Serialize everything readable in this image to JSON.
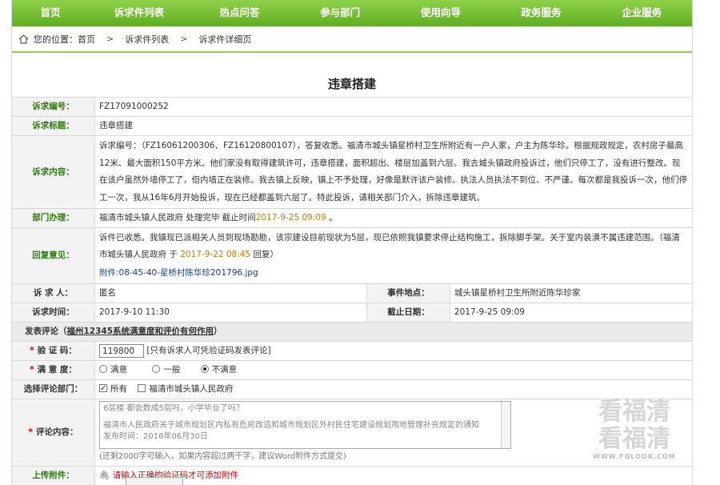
{
  "nav": [
    "首页",
    "诉求件列表",
    "热点问答",
    "参与部门",
    "使用向导",
    "政务服务",
    "企业服务"
  ],
  "breadcrumb": {
    "prefix": "您的位置：",
    "items": [
      "首页",
      "诉求件列表",
      "诉求件详细页"
    ]
  },
  "title": "违章搭建",
  "detail": {
    "id_label": "诉求编号：",
    "id": "FZ17091000252",
    "subject_label": "诉求标题：",
    "subject": "违章搭建",
    "content_label": "诉求内容：",
    "content": "诉求编号：（FZ16061200306、FZ16120800107），答复收悉。福清市城头镇星桥村卫生所附近有一户人家，户主为陈华珍。根据规政规定，农村房子最高12米、最大面积150平方米。他们家没有取得建筑许可，违章搭建，面积超出、楼层加盖到六层。我去城头镇政府投诉过，他们只停工了，没有进行整改。现在该户虽然外墙停工了，但内墙正在装修。我去镇上反映，镇上不予处理，好像是默许该户装修。执法人员执法不到位、不严谨。每次都是我投诉一次，他们停工一次，我从16年6月开始投诉，现在已经都盖到六层了。特此投诉，请相关部门介入，拆除违章建筑。",
    "dept_label": "部门办理：",
    "dept_text": "福清市城头镇人民政府  处理完毕  截止时间",
    "dept_deadline": "2017-9-25 09:09",
    "dept_end": " 。",
    "reply_label": "回复意见：",
    "reply": "诉件已收悉。我镇现已派相关人员到现场勘勘，该宗建设目前现状为5层，现已依照我镇要求停止结构施工，拆除脚手架。关于室内装潢不属违建范围。（福清市城头镇人民政府  于 ",
    "reply_time": "2017-9-22 08:45",
    "reply_end": " 回复）",
    "attachment": "附件:08-45-40-星桥村陈华珍201796.jpg",
    "person_label": "诉 求 人：",
    "person": "匿名",
    "place_label": "事件地点：",
    "place": "城头镇星桥村卫生所附近陈华珍家",
    "time_label": "诉求时间：",
    "time": "2017-9-10 11:30",
    "deadline_label": "截止日期：",
    "deadline": "2017-9-25 09:09"
  },
  "comment": {
    "section_prefix": "发表评论（",
    "section_link": "福州12345系统满意度和评价有何作用",
    "section_suffix": "）",
    "code_label": "验 证 码：",
    "code_value": "119800",
    "code_hint": "[只有诉求人可凭验证码发表评论]",
    "satisfaction_label": "满 意 度：",
    "satisfaction_options": [
      "满意",
      "一般",
      "不满意"
    ],
    "dept_label": "选择评论部门：",
    "dept_options": [
      "所有",
      "福清市城头镇人民政府"
    ],
    "content_label": "评论内容：",
    "textarea_lines": [
      "6层楼  都会数成5层吗，小学毕业了吗？",
      "",
      "福清市人民政府关于城市规划区内私有危房改造和城市规划区外村民住宅建设规划用地管理补充规定的通知",
      "       发布时间：2016年06月30日"
    ],
    "textarea_hint": "(还剩2000字可输入，如果内容超过两千字，建议Word附件方式提交)",
    "attach_label": "上传附件：",
    "attach_text": "请输入正确的验证码才可添加附件"
  },
  "watermark": {
    "line1": "看福清",
    "line2": "看福清",
    "url": "WWW.FQLOOK.COM"
  }
}
